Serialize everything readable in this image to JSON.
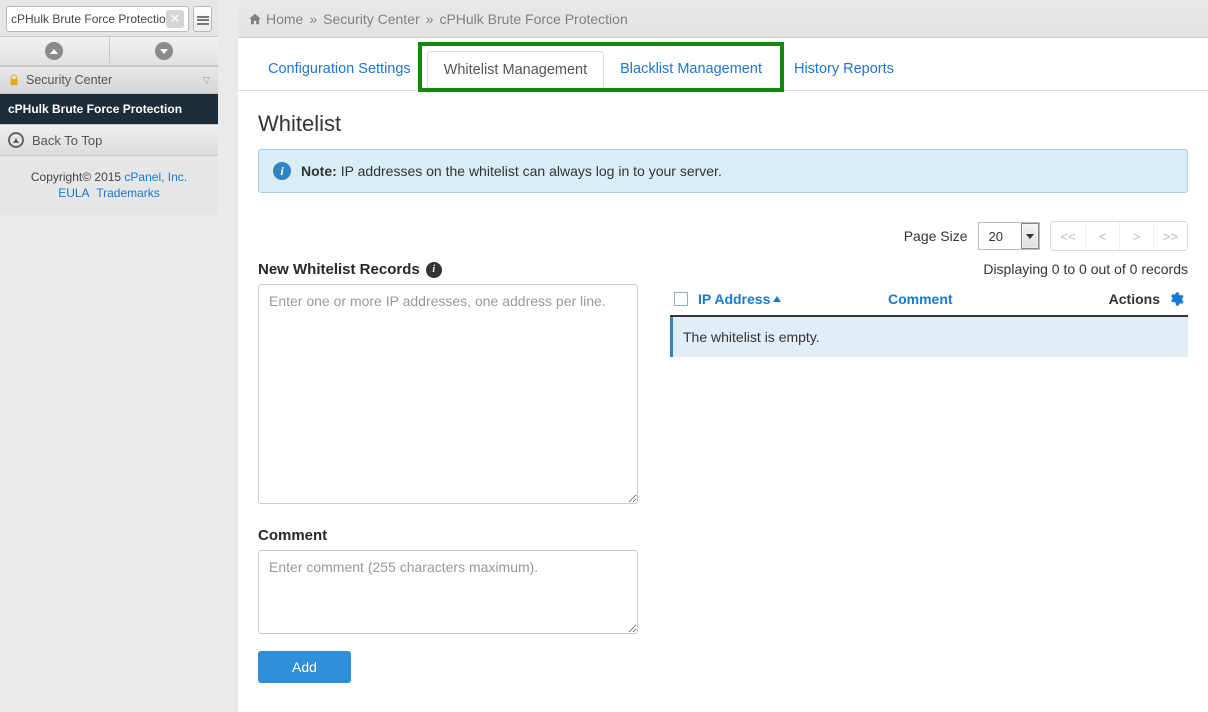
{
  "breadcrumb": {
    "home": "Home",
    "sec": "Security Center",
    "page": "cPHulk Brute Force Protection"
  },
  "sidebar": {
    "search_value": "cPHulk Brute Force Protection",
    "section": "Security Center",
    "active": "cPHulk Brute Force Protection",
    "back": "Back To Top",
    "copyright": "Copyright© 2015 ",
    "cpanel": "cPanel, Inc.",
    "eula": "EULA",
    "trademarks": "Trademarks"
  },
  "tabs": {
    "config": "Configuration Settings",
    "whitelist": "Whitelist Management",
    "blacklist": "Blacklist Management",
    "history": "History Reports"
  },
  "page": {
    "title": "Whitelist",
    "note_label": "Note:",
    "note_text": "IP addresses on the whitelist can always log in to your server."
  },
  "form": {
    "records_label": "New Whitelist Records",
    "records_placeholder": "Enter one or more IP addresses, one address per line.",
    "comment_label": "Comment",
    "comment_placeholder": "Enter comment (255 characters maximum).",
    "add": "Add"
  },
  "table": {
    "page_size_label": "Page Size",
    "page_size_value": "20",
    "displaying": "Displaying 0 to 0 out of 0 records",
    "col_ip": "IP Address",
    "col_comment": "Comment",
    "col_actions": "Actions",
    "empty": "The whitelist is empty.",
    "pager": {
      "first": "<<",
      "prev": "<",
      "next": ">",
      "last": ">>"
    }
  }
}
